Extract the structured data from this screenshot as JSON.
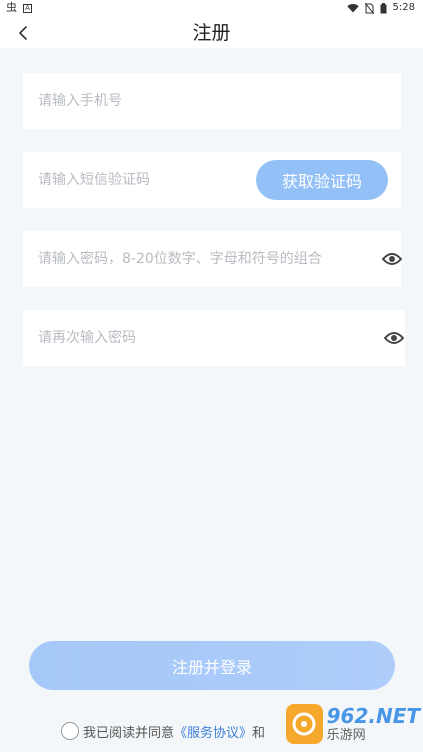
{
  "status_bar": {
    "left_glyph": "虫",
    "left_badge": "A",
    "time": "5:28"
  },
  "header": {
    "title": "注册"
  },
  "form": {
    "phone_placeholder": "请输入手机号",
    "sms_code_placeholder": "请输入短信验证码",
    "get_code_label": "获取验证码",
    "password_placeholder": "请输入密码，8-20位数字、字母和符号的组合",
    "confirm_password_placeholder": "请再次输入密码"
  },
  "submit_label": "注册并登录",
  "agreement": {
    "prefix": "我已阅读并同意",
    "service_link": "《服务协议》",
    "joiner": "和"
  },
  "watermark": {
    "brand": "962.NET",
    "sub": "乐游网"
  },
  "colors": {
    "background": "#f4f7f9",
    "code_button": "#93c1f7",
    "submit_button": "#a4c8f8",
    "link": "#3b7fd6"
  },
  "icons": {
    "back": "chevron-left-icon",
    "eye": "eye-icon",
    "wifi": "wifi-icon",
    "battery": "battery-icon"
  }
}
